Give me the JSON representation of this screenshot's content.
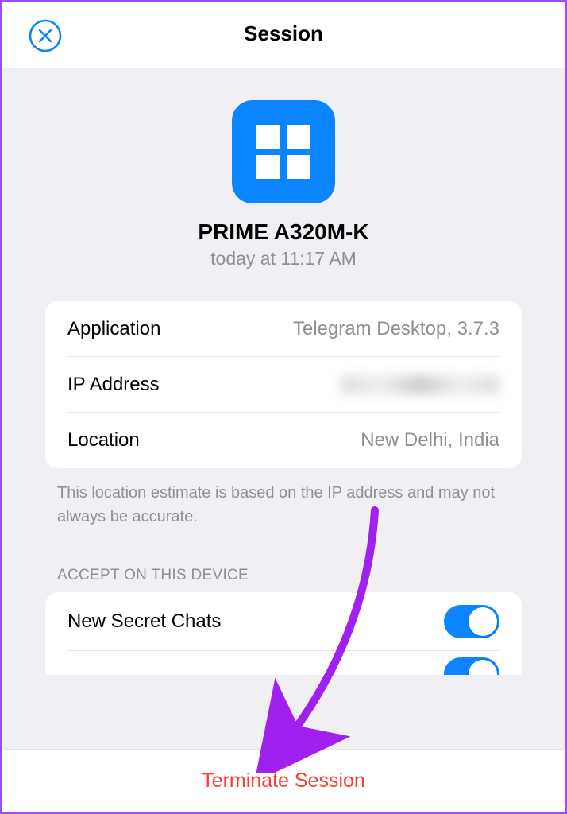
{
  "header": {
    "title": "Session"
  },
  "device": {
    "name": "PRIME A320M-K",
    "time": "today at 11:17 AM"
  },
  "details": {
    "application_label": "Application",
    "application_value": "Telegram Desktop, 3.7.3",
    "ip_label": "IP Address",
    "ip_value": "",
    "location_label": "Location",
    "location_value": "New Delhi, India"
  },
  "note": "This location estimate is based on the IP address and may not always be accurate.",
  "accept_section": {
    "title": "ACCEPT ON THIS DEVICE",
    "secret_chats_label": "New Secret Chats",
    "secret_chats_on": true
  },
  "footer": {
    "terminate": "Terminate Session"
  },
  "colors": {
    "accent": "#0a84ff",
    "destructive": "#ff3b30",
    "annotation": "#a020f0"
  }
}
